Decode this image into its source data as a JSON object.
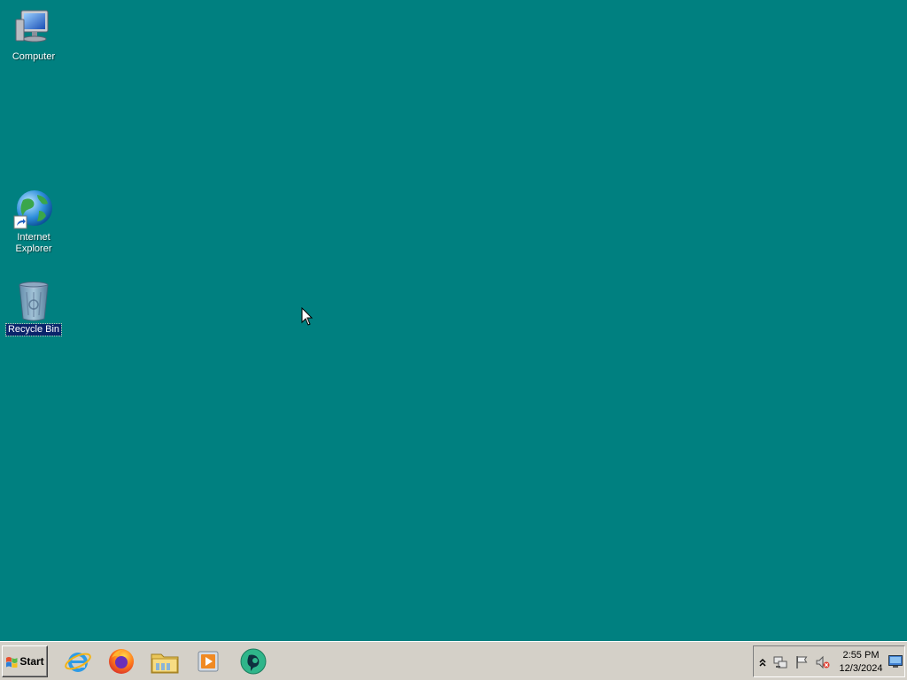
{
  "desktop": {
    "background_color": "#008080",
    "icons": [
      {
        "label": "Computer",
        "icon": "computer-icon",
        "selected": false
      },
      {
        "label": "Internet Explorer",
        "icon": "internet-explorer-globe-icon",
        "shortcut": true,
        "selected": false
      },
      {
        "label": "Recycle Bin",
        "icon": "recycle-bin-icon",
        "selected": true
      }
    ]
  },
  "taskbar": {
    "start_label": "Start",
    "pinned": [
      {
        "name": "Internet Explorer",
        "icon": "internet-explorer-icon"
      },
      {
        "name": "Firefox",
        "icon": "firefox-icon"
      },
      {
        "name": "Windows Explorer",
        "icon": "folder-icon"
      },
      {
        "name": "Media Player",
        "icon": "media-player-icon"
      },
      {
        "name": "App",
        "icon": "green-app-icon"
      }
    ],
    "tray": {
      "icons": [
        "show-hidden-icons-chevron",
        "network-icon",
        "action-center-flag-icon",
        "volume-muted-icon"
      ],
      "clock": {
        "time": "2:55 PM",
        "date": "12/3/2024"
      }
    }
  }
}
